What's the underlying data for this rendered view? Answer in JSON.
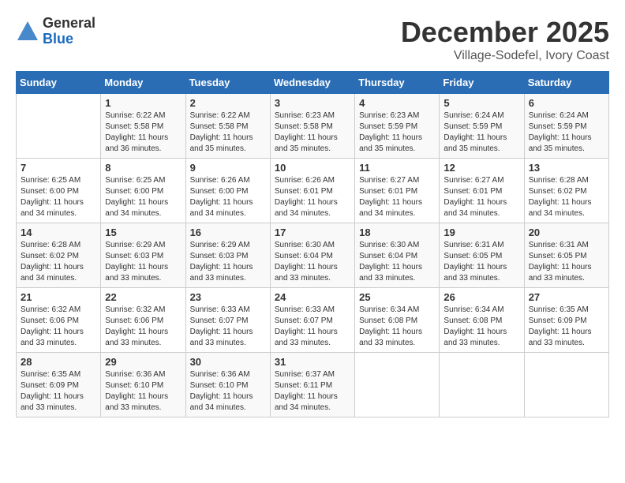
{
  "logo": {
    "general": "General",
    "blue": "Blue"
  },
  "header": {
    "month": "December 2025",
    "location": "Village-Sodefel, Ivory Coast"
  },
  "weekdays": [
    "Sunday",
    "Monday",
    "Tuesday",
    "Wednesday",
    "Thursday",
    "Friday",
    "Saturday"
  ],
  "weeks": [
    [
      {
        "day": "",
        "sunrise": "",
        "sunset": "",
        "daylight": ""
      },
      {
        "day": "1",
        "sunrise": "Sunrise: 6:22 AM",
        "sunset": "Sunset: 5:58 PM",
        "daylight": "Daylight: 11 hours and 36 minutes."
      },
      {
        "day": "2",
        "sunrise": "Sunrise: 6:22 AM",
        "sunset": "Sunset: 5:58 PM",
        "daylight": "Daylight: 11 hours and 35 minutes."
      },
      {
        "day": "3",
        "sunrise": "Sunrise: 6:23 AM",
        "sunset": "Sunset: 5:58 PM",
        "daylight": "Daylight: 11 hours and 35 minutes."
      },
      {
        "day": "4",
        "sunrise": "Sunrise: 6:23 AM",
        "sunset": "Sunset: 5:59 PM",
        "daylight": "Daylight: 11 hours and 35 minutes."
      },
      {
        "day": "5",
        "sunrise": "Sunrise: 6:24 AM",
        "sunset": "Sunset: 5:59 PM",
        "daylight": "Daylight: 11 hours and 35 minutes."
      },
      {
        "day": "6",
        "sunrise": "Sunrise: 6:24 AM",
        "sunset": "Sunset: 5:59 PM",
        "daylight": "Daylight: 11 hours and 35 minutes."
      }
    ],
    [
      {
        "day": "7",
        "sunrise": "Sunrise: 6:25 AM",
        "sunset": "Sunset: 6:00 PM",
        "daylight": "Daylight: 11 hours and 34 minutes."
      },
      {
        "day": "8",
        "sunrise": "Sunrise: 6:25 AM",
        "sunset": "Sunset: 6:00 PM",
        "daylight": "Daylight: 11 hours and 34 minutes."
      },
      {
        "day": "9",
        "sunrise": "Sunrise: 6:26 AM",
        "sunset": "Sunset: 6:00 PM",
        "daylight": "Daylight: 11 hours and 34 minutes."
      },
      {
        "day": "10",
        "sunrise": "Sunrise: 6:26 AM",
        "sunset": "Sunset: 6:01 PM",
        "daylight": "Daylight: 11 hours and 34 minutes."
      },
      {
        "day": "11",
        "sunrise": "Sunrise: 6:27 AM",
        "sunset": "Sunset: 6:01 PM",
        "daylight": "Daylight: 11 hours and 34 minutes."
      },
      {
        "day": "12",
        "sunrise": "Sunrise: 6:27 AM",
        "sunset": "Sunset: 6:01 PM",
        "daylight": "Daylight: 11 hours and 34 minutes."
      },
      {
        "day": "13",
        "sunrise": "Sunrise: 6:28 AM",
        "sunset": "Sunset: 6:02 PM",
        "daylight": "Daylight: 11 hours and 34 minutes."
      }
    ],
    [
      {
        "day": "14",
        "sunrise": "Sunrise: 6:28 AM",
        "sunset": "Sunset: 6:02 PM",
        "daylight": "Daylight: 11 hours and 34 minutes."
      },
      {
        "day": "15",
        "sunrise": "Sunrise: 6:29 AM",
        "sunset": "Sunset: 6:03 PM",
        "daylight": "Daylight: 11 hours and 33 minutes."
      },
      {
        "day": "16",
        "sunrise": "Sunrise: 6:29 AM",
        "sunset": "Sunset: 6:03 PM",
        "daylight": "Daylight: 11 hours and 33 minutes."
      },
      {
        "day": "17",
        "sunrise": "Sunrise: 6:30 AM",
        "sunset": "Sunset: 6:04 PM",
        "daylight": "Daylight: 11 hours and 33 minutes."
      },
      {
        "day": "18",
        "sunrise": "Sunrise: 6:30 AM",
        "sunset": "Sunset: 6:04 PM",
        "daylight": "Daylight: 11 hours and 33 minutes."
      },
      {
        "day": "19",
        "sunrise": "Sunrise: 6:31 AM",
        "sunset": "Sunset: 6:05 PM",
        "daylight": "Daylight: 11 hours and 33 minutes."
      },
      {
        "day": "20",
        "sunrise": "Sunrise: 6:31 AM",
        "sunset": "Sunset: 6:05 PM",
        "daylight": "Daylight: 11 hours and 33 minutes."
      }
    ],
    [
      {
        "day": "21",
        "sunrise": "Sunrise: 6:32 AM",
        "sunset": "Sunset: 6:06 PM",
        "daylight": "Daylight: 11 hours and 33 minutes."
      },
      {
        "day": "22",
        "sunrise": "Sunrise: 6:32 AM",
        "sunset": "Sunset: 6:06 PM",
        "daylight": "Daylight: 11 hours and 33 minutes."
      },
      {
        "day": "23",
        "sunrise": "Sunrise: 6:33 AM",
        "sunset": "Sunset: 6:07 PM",
        "daylight": "Daylight: 11 hours and 33 minutes."
      },
      {
        "day": "24",
        "sunrise": "Sunrise: 6:33 AM",
        "sunset": "Sunset: 6:07 PM",
        "daylight": "Daylight: 11 hours and 33 minutes."
      },
      {
        "day": "25",
        "sunrise": "Sunrise: 6:34 AM",
        "sunset": "Sunset: 6:08 PM",
        "daylight": "Daylight: 11 hours and 33 minutes."
      },
      {
        "day": "26",
        "sunrise": "Sunrise: 6:34 AM",
        "sunset": "Sunset: 6:08 PM",
        "daylight": "Daylight: 11 hours and 33 minutes."
      },
      {
        "day": "27",
        "sunrise": "Sunrise: 6:35 AM",
        "sunset": "Sunset: 6:09 PM",
        "daylight": "Daylight: 11 hours and 33 minutes."
      }
    ],
    [
      {
        "day": "28",
        "sunrise": "Sunrise: 6:35 AM",
        "sunset": "Sunset: 6:09 PM",
        "daylight": "Daylight: 11 hours and 33 minutes."
      },
      {
        "day": "29",
        "sunrise": "Sunrise: 6:36 AM",
        "sunset": "Sunset: 6:10 PM",
        "daylight": "Daylight: 11 hours and 33 minutes."
      },
      {
        "day": "30",
        "sunrise": "Sunrise: 6:36 AM",
        "sunset": "Sunset: 6:10 PM",
        "daylight": "Daylight: 11 hours and 34 minutes."
      },
      {
        "day": "31",
        "sunrise": "Sunrise: 6:37 AM",
        "sunset": "Sunset: 6:11 PM",
        "daylight": "Daylight: 11 hours and 34 minutes."
      },
      {
        "day": "",
        "sunrise": "",
        "sunset": "",
        "daylight": ""
      },
      {
        "day": "",
        "sunrise": "",
        "sunset": "",
        "daylight": ""
      },
      {
        "day": "",
        "sunrise": "",
        "sunset": "",
        "daylight": ""
      }
    ]
  ]
}
